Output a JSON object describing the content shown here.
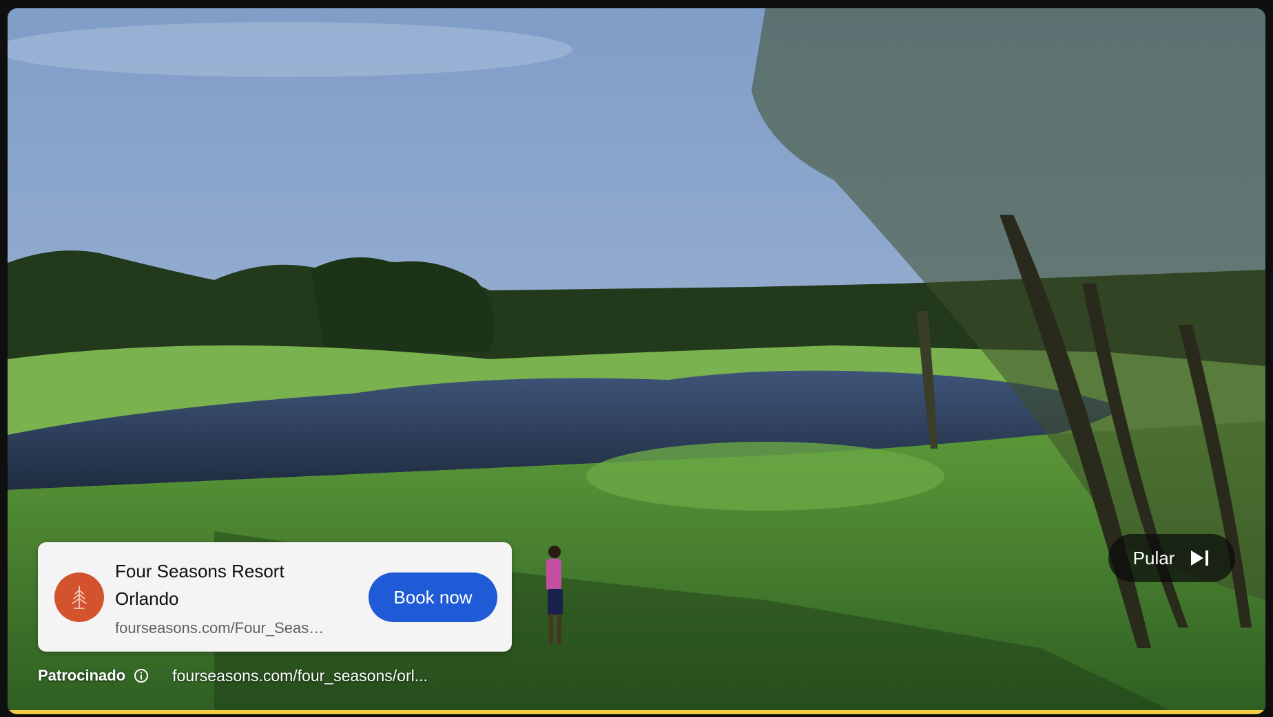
{
  "ad": {
    "title": "Four Seasons Resort Orlando",
    "display_url": "fourseasons.com/Four_Seas…",
    "cta_label": "Book now",
    "logo_icon": "tree-icon",
    "logo_color": "#d4532f",
    "cta_color": "#1f5bd6"
  },
  "sponsor": {
    "label": "Patrocinado",
    "info_icon": "info-icon",
    "link_text": "fourseasons.com/four_seasons/orl..."
  },
  "skip": {
    "label": "Pular",
    "icon": "skip-next-icon"
  },
  "progress": {
    "fraction": 1.0,
    "color": "#f2cd45"
  }
}
